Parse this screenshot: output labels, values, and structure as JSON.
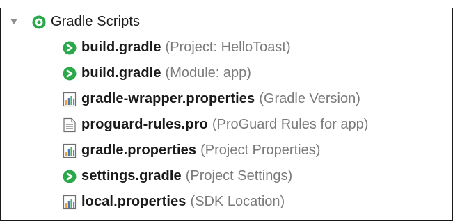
{
  "tree": {
    "root": {
      "label": "Gradle Scripts",
      "icon": "gradle-scripts-icon",
      "expanded": true
    },
    "items": [
      {
        "name": "build.gradle",
        "description": "(Project: HelloToast)",
        "icon": "gradle-icon"
      },
      {
        "name": "build.gradle",
        "description": "(Module: app)",
        "icon": "gradle-icon"
      },
      {
        "name": "gradle-wrapper.properties",
        "description": "(Gradle Version)",
        "icon": "properties-file-icon"
      },
      {
        "name": "proguard-rules.pro",
        "description": "(ProGuard Rules for app)",
        "icon": "text-file-icon"
      },
      {
        "name": "gradle.properties",
        "description": "(Project Properties)",
        "icon": "properties-file-icon"
      },
      {
        "name": "settings.gradle",
        "description": "(Project Settings)",
        "icon": "gradle-icon"
      },
      {
        "name": "local.properties",
        "description": "(SDK Location)",
        "icon": "properties-file-icon"
      }
    ]
  },
  "colors": {
    "gradle_green": "#2aa84a",
    "chart_orange": "#f0a23a",
    "chart_blue": "#4a78c2",
    "chart_green": "#56b06b",
    "description_gray": "#7a7a7a"
  }
}
